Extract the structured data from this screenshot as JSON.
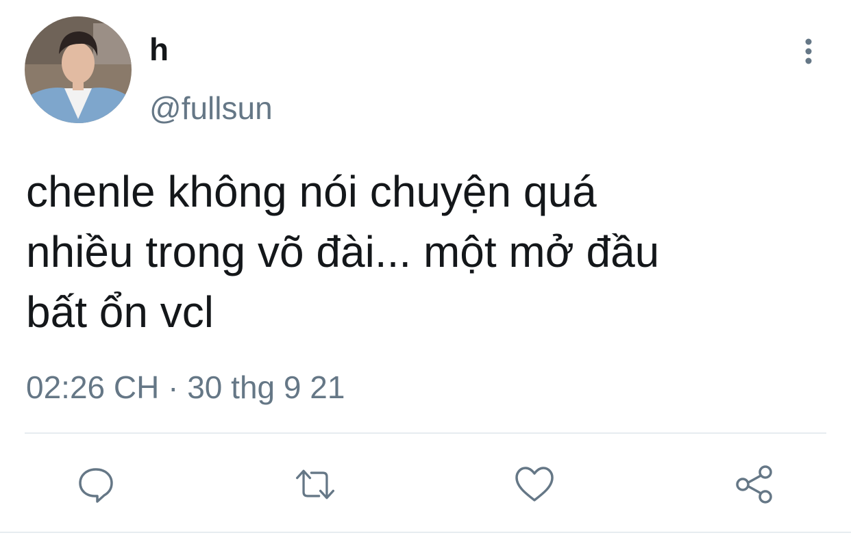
{
  "tweet": {
    "author": {
      "display_name": "h",
      "handle": "@fullsun",
      "avatar_icon": "avatar-photo"
    },
    "text": "chenle không nói chuyện quá\nnhiều trong võ đài... một mở đầu\nbất ổn vcl",
    "timestamp": "02:26 CH · 30 thg 9 21"
  },
  "actions": [
    {
      "name": "reply",
      "icon": "comment-icon"
    },
    {
      "name": "retweet",
      "icon": "retweet-icon"
    },
    {
      "name": "like",
      "icon": "heart-icon"
    },
    {
      "name": "share",
      "icon": "share-icon"
    }
  ],
  "colors": {
    "text_primary": "#14171a",
    "text_secondary": "#657786",
    "divider": "#e6ecf0"
  }
}
